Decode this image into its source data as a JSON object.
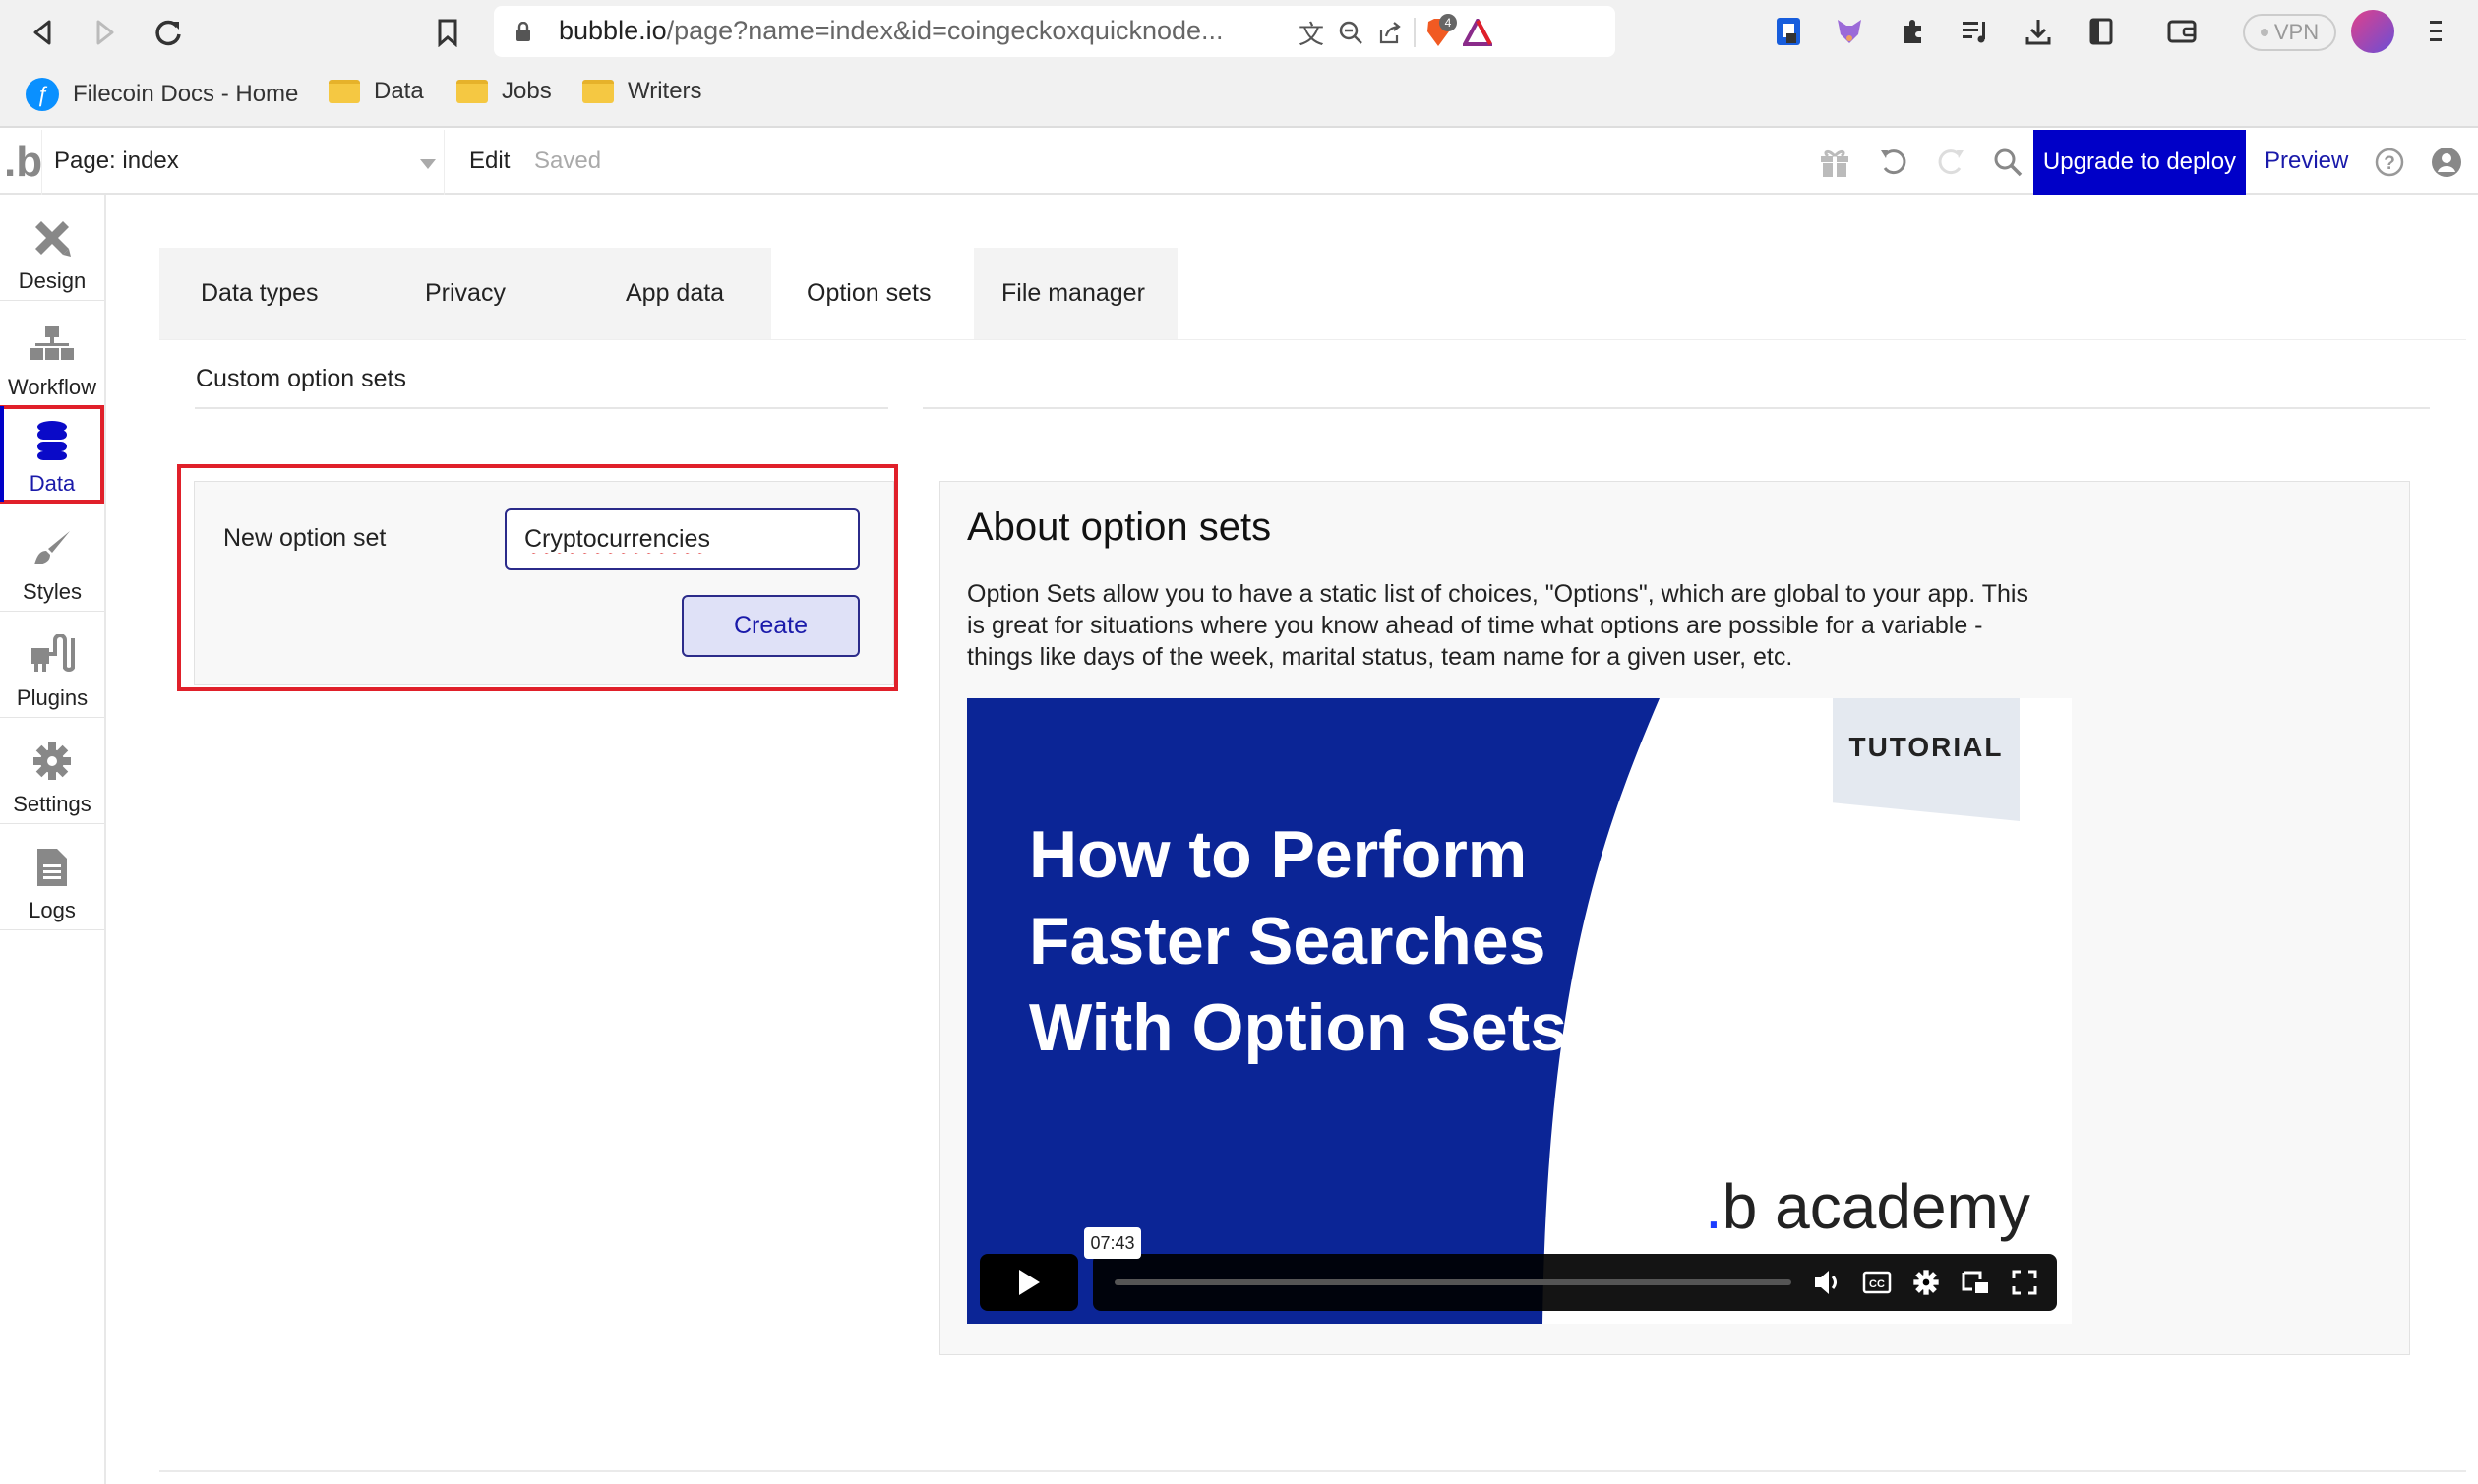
{
  "browser": {
    "url_host": "bubble.io",
    "url_path": "/page?name=index&id=coingeckoxquicknode...",
    "brave_badge_count": "4",
    "vpn_label": "VPN",
    "bookmarks": [
      {
        "label": "Filecoin Docs - Home",
        "icon": "filecoin-icon"
      },
      {
        "label": "Data",
        "icon": "folder-icon"
      },
      {
        "label": "Jobs",
        "icon": "folder-icon"
      },
      {
        "label": "Writers",
        "icon": "folder-icon"
      }
    ]
  },
  "toolbar": {
    "logo": ".b",
    "page_label": "Page: index",
    "edit_label": "Edit",
    "saved_label": "Saved",
    "upgrade_label": "Upgrade to deploy",
    "preview_label": "Preview"
  },
  "sidebar": {
    "items": [
      {
        "label": "Design",
        "icon": "design-icon"
      },
      {
        "label": "Workflow",
        "icon": "workflow-icon"
      },
      {
        "label": "Data",
        "icon": "database-icon",
        "active": true
      },
      {
        "label": "Styles",
        "icon": "brush-icon"
      },
      {
        "label": "Plugins",
        "icon": "plug-icon"
      },
      {
        "label": "Settings",
        "icon": "gear-icon"
      },
      {
        "label": "Logs",
        "icon": "document-icon"
      }
    ]
  },
  "tabs": [
    {
      "label": "Data types",
      "active": false
    },
    {
      "label": "Privacy",
      "active": false
    },
    {
      "label": "App data",
      "active": false
    },
    {
      "label": "Option sets",
      "active": true
    },
    {
      "label": "File manager",
      "active": false
    }
  ],
  "main": {
    "section_title": "Custom option sets",
    "new_option_set": {
      "label": "New option set",
      "input_value": "Cryptocurrencies",
      "create_label": "Create"
    },
    "about": {
      "title": "About option sets",
      "text": "Option Sets allow you to have a static list of choices, \"Options\", which are global to your app. This is great for situations where you know ahead of time what options are possible for a variable - things like days of the week, marital status, team name for a given user, etc."
    },
    "video": {
      "badge": "TUTORIAL",
      "title": "How to Perform Faster Searches With Option Sets",
      "brand_dot": ".",
      "brand": "b academy",
      "duration": "07:43",
      "progress": 0
    }
  },
  "colors": {
    "accent": "#0000c8",
    "highlight": "#e0202a",
    "video_blue": "#0b2596"
  }
}
